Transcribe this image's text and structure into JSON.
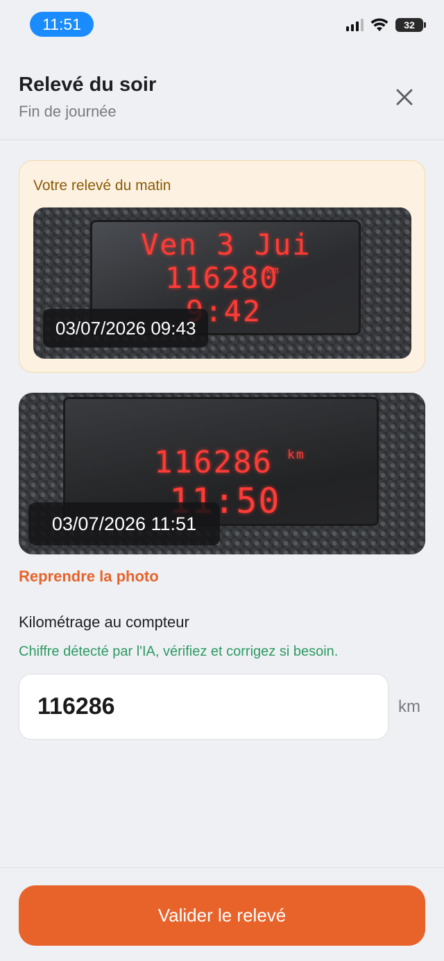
{
  "status_bar": {
    "time": "11:51",
    "battery": "32",
    "accent_color": "#1a8cff"
  },
  "header": {
    "title": "Relevé du soir",
    "subtitle": "Fin de journée",
    "close_icon": "close-icon"
  },
  "morning": {
    "label": "Votre relevé du matin",
    "photo_lines": [
      "Ven  3 Jui",
      "116280",
      "km",
      "9:42"
    ],
    "timestamp": "03/07/2026 09:43"
  },
  "evening": {
    "photo_lines": [
      "116286",
      "km",
      "11:50"
    ],
    "timestamp": "03/07/2026 11:51"
  },
  "retake_label": "Reprendre la photo",
  "odometer": {
    "label": "Kilométrage au compteur",
    "hint": "Chiffre détecté par l'IA, vérifiez et corrigez si besoin.",
    "value": "116286",
    "unit": "km"
  },
  "submit_label": "Valider le relevé",
  "colors": {
    "brand": "#e8632a",
    "hint": "#2e9a63",
    "morning_bg": "#fdf2e2",
    "lcd_red": "#ff3b36"
  }
}
